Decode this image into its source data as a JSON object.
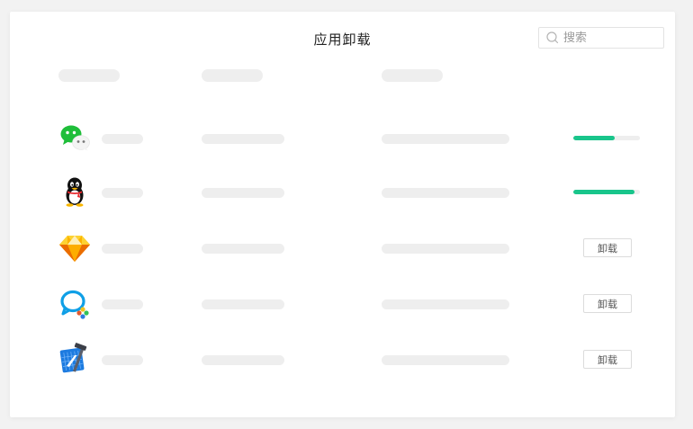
{
  "window": {
    "title": "应用卸载"
  },
  "search": {
    "placeholder": "搜索",
    "value": ""
  },
  "apps": [
    {
      "icon": "wechat-icon",
      "state": "uninstalling",
      "progress": 0.62
    },
    {
      "icon": "qq-penguin-icon",
      "state": "uninstalling",
      "progress": 0.92
    },
    {
      "icon": "sketch-diamond-icon",
      "state": "idle",
      "action_label": "卸载"
    },
    {
      "icon": "wecom-chat-icon",
      "state": "idle",
      "action_label": "卸载"
    },
    {
      "icon": "xcode-icon",
      "state": "idle",
      "action_label": "卸载"
    }
  ],
  "colors": {
    "accent": "#19c58b",
    "skeleton": "#eeeeee",
    "window_bg": "#ffffff",
    "page_bg": "#f2f2f2"
  }
}
